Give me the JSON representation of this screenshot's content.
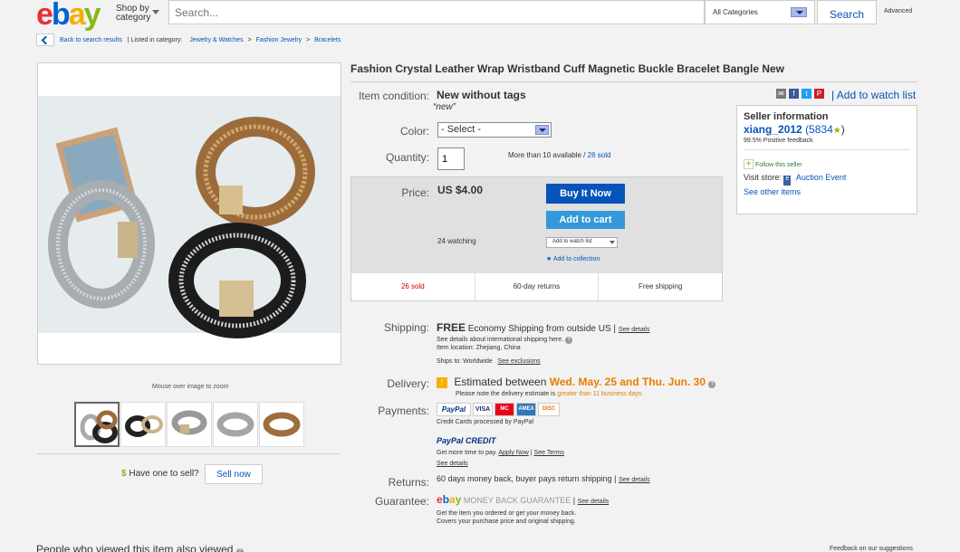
{
  "header": {
    "logo_letters": [
      "e",
      "b",
      "a",
      "y"
    ],
    "logo_colors": [
      "#e53238",
      "#0064d2",
      "#f5af02",
      "#86b817"
    ],
    "shop_by": [
      "Shop by",
      "category"
    ],
    "search_placeholder": "Search...",
    "category": "All Categories",
    "search_button": "Search",
    "advanced": "Advanced"
  },
  "breadcrumb": {
    "back": "Back to search results",
    "listed_in": "| Listed in category:",
    "items": [
      "Jewelry & Watches",
      "Fashion Jewelry",
      "Bracelets"
    ],
    "sep": ">"
  },
  "gallery": {
    "zoom_hint": "Mouse over image to zoom",
    "thumbnail_count": 5
  },
  "sell": {
    "label": "Have one to sell?",
    "button": "Sell now",
    "dollar": "$"
  },
  "item": {
    "title": "Fashion Crystal Leather Wrap Wristband Cuff Magnetic Buckle Bracelet Bangle New",
    "condition_label": "Item condition:",
    "condition": "New without tags",
    "condition_note": "“new”",
    "color_label": "Color:",
    "color_value": "- Select -",
    "quantity_label": "Quantity:",
    "quantity_value": "1",
    "available": "More than 10 available",
    "available_sep": " / ",
    "sold_link": "26 sold",
    "price_label": "Price:",
    "price": "US $4.00",
    "buy_now": "Buy It Now",
    "add_cart": "Add to cart",
    "watching": "24 watching",
    "add_watch_small": "Add to watch list",
    "add_collection": "Add to collection",
    "stats": [
      "26 sold",
      "60-day returns",
      "Free shipping"
    ],
    "watch_list_link": "| Add to watch list"
  },
  "seller": {
    "heading": "Seller information",
    "name": "xiang_2012",
    "score": "(5834",
    "score_end": ")",
    "feedback": "99.5% Positive feedback",
    "follow": "Follow this seller",
    "visit_label": "Visit store:",
    "store": "Auction Event",
    "other": "See other items"
  },
  "shipping": {
    "label": "Shipping:",
    "free": "FREE",
    "method": "Economy Shipping from outside US",
    "see_details": "See details",
    "intl": "See details about international shipping here.",
    "location": "Item location: Zhejiang, China",
    "ships_to": "Ships to: Worldwide",
    "exclusions": "See exclusions"
  },
  "delivery": {
    "label": "Delivery:",
    "estimated": "Estimated between",
    "dates": "Wed. May. 25 and Thu. Jun. 30",
    "note": "Please note the delivery estimate is",
    "note_hl": "greater than 11 business days."
  },
  "payments": {
    "label": "Payments:",
    "paypal": "PayPal",
    "cards": [
      "VISA",
      "MC",
      "AMEX",
      "DISC"
    ],
    "card_note": "Credit Cards processed by PayPal",
    "credit": "PayPal CREDIT",
    "credit_note": "Get more time to pay.",
    "apply": "Apply Now",
    "terms": "See Terms",
    "see_details": "See details"
  },
  "returns": {
    "label": "Returns:",
    "text": "60 days money back, buyer pays return shipping",
    "see_details": "See details"
  },
  "guarantee": {
    "label": "Guarantee:",
    "badge": "MONEY BACK GUARANTEE",
    "see_details": "See details",
    "line1": "Get the item you ordered or get your money back.",
    "line2": "Covers your purchase price and original shipping."
  },
  "footer": {
    "viewed": "People who viewed this item also viewed",
    "feedback": "Feedback on our suggestions"
  }
}
